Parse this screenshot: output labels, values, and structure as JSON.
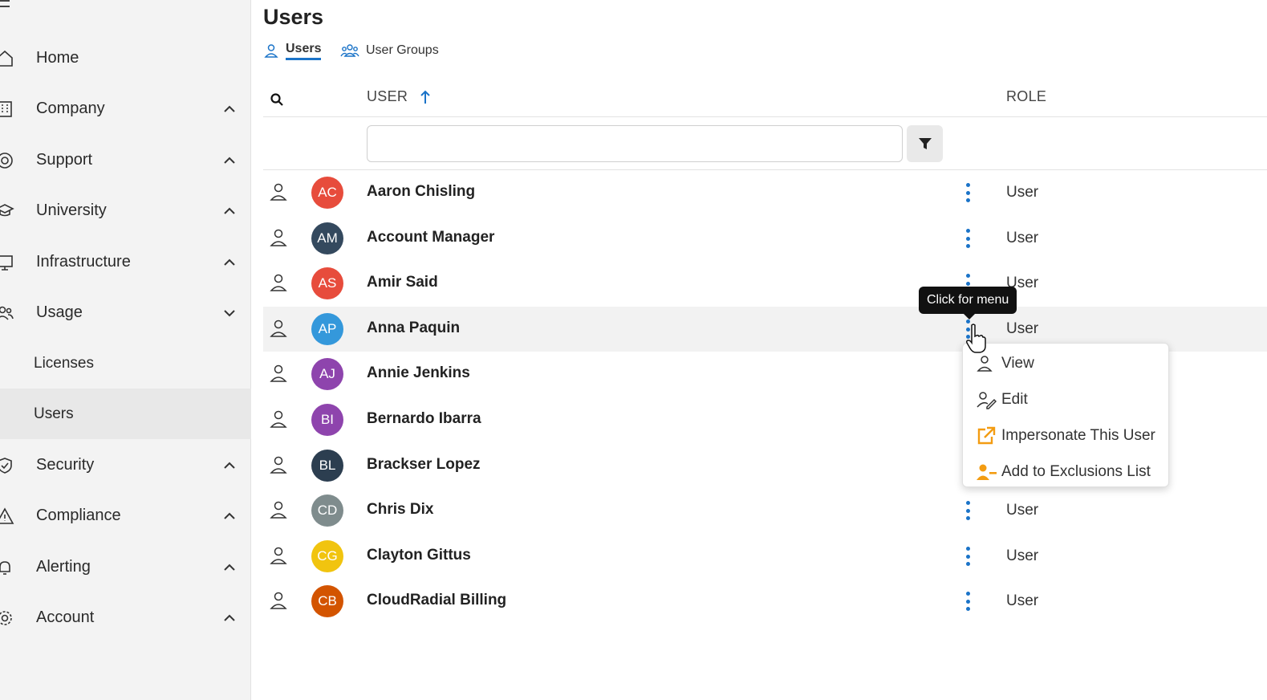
{
  "sidebar": {
    "items": [
      {
        "label": "Home",
        "icon": "home-icon"
      },
      {
        "label": "Company",
        "icon": "building-icon"
      },
      {
        "label": "Support",
        "icon": "lifebuoy-icon"
      },
      {
        "label": "University",
        "icon": "graduation-cap-icon"
      },
      {
        "label": "Infrastructure",
        "icon": "monitor-icon"
      },
      {
        "label": "Usage",
        "icon": "users-icon"
      },
      {
        "label": "Security",
        "icon": "shield-icon"
      },
      {
        "label": "Compliance",
        "icon": "warning-icon"
      },
      {
        "label": "Alerting",
        "icon": "bell-icon"
      },
      {
        "label": "Account",
        "icon": "gear-icon"
      }
    ],
    "usage_sub": [
      {
        "label": "Licenses"
      },
      {
        "label": "Users"
      }
    ]
  },
  "page": {
    "title": "Users",
    "tabs": [
      {
        "label": "Users"
      },
      {
        "label": "User Groups"
      }
    ]
  },
  "table": {
    "columns": {
      "user": "USER",
      "role": "ROLE"
    },
    "filter_placeholder": "",
    "rows": [
      {
        "initials": "AC",
        "name": "Aaron Chisling",
        "role": "User",
        "color": "#e74c3c"
      },
      {
        "initials": "AM",
        "name": "Account Manager",
        "role": "User",
        "color": "#34495e"
      },
      {
        "initials": "AS",
        "name": "Amir Said",
        "role": "User",
        "color": "#e74c3c"
      },
      {
        "initials": "AP",
        "name": "Anna Paquin",
        "role": "User",
        "color": "#3498db"
      },
      {
        "initials": "AJ",
        "name": "Annie Jenkins",
        "role": "",
        "color": "#8e44ad"
      },
      {
        "initials": "BI",
        "name": "Bernardo Ibarra",
        "role": "",
        "color": "#8e44ad"
      },
      {
        "initials": "BL",
        "name": "Brackser Lopez",
        "role": "",
        "color": "#2c3e50"
      },
      {
        "initials": "CD",
        "name": "Chris Dix",
        "role": "User",
        "color": "#7f8c8d"
      },
      {
        "initials": "CG",
        "name": "Clayton Gittus",
        "role": "User",
        "color": "#f1c40f"
      },
      {
        "initials": "CB",
        "name": "CloudRadial Billing",
        "role": "User",
        "color": "#d35400"
      }
    ]
  },
  "tooltip": {
    "text": "Click for menu"
  },
  "context_menu": {
    "items": [
      {
        "label": "View",
        "icon": "person-icon"
      },
      {
        "label": "Edit",
        "icon": "person-edit-icon"
      },
      {
        "label": "Impersonate This User",
        "icon": "external-link-icon"
      },
      {
        "label": "Add to Exclusions List",
        "icon": "person-minus-icon"
      }
    ]
  },
  "colors": {
    "accent": "#1a73c8",
    "orange": "#f39c12"
  }
}
